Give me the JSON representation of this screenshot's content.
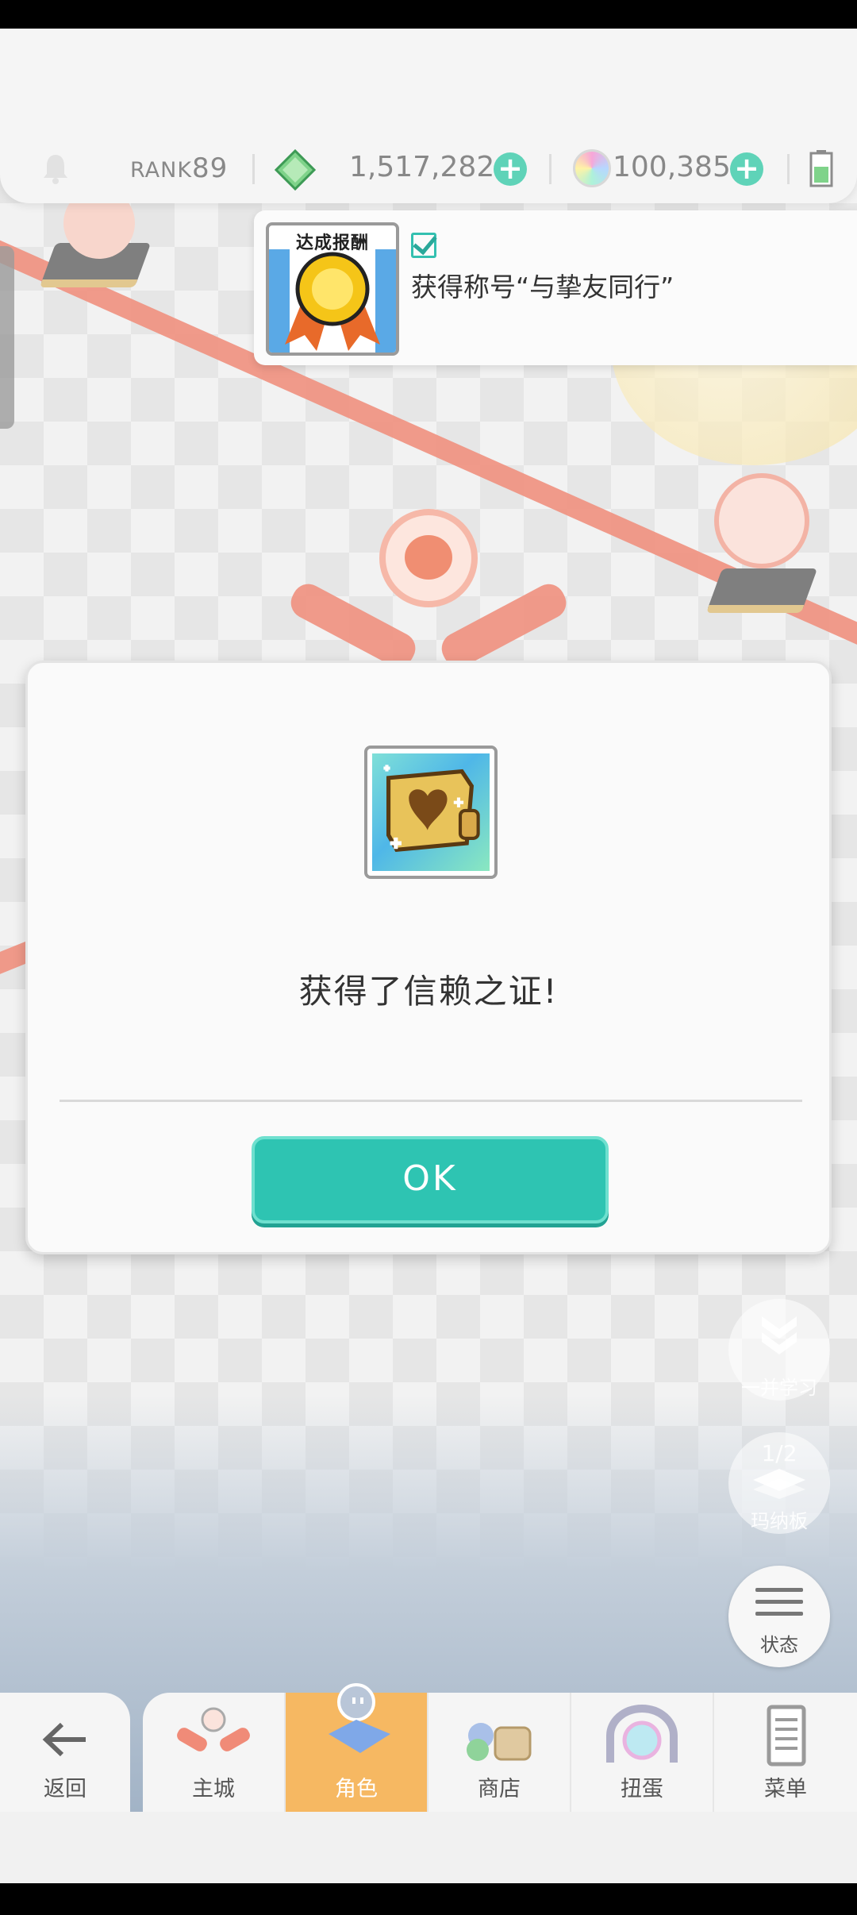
{
  "topbar": {
    "rank_prefix": "RANK",
    "rank_value": "89",
    "gems": "1,517,282",
    "orbs": "100,385",
    "plus_symbol": "+"
  },
  "toast": {
    "badge_label": "达成报酬",
    "message": "获得称号“与挚友同行”"
  },
  "dialog": {
    "message": "获得了信赖之证!",
    "ok_label": "OK"
  },
  "side_buttons": {
    "study_label": "一并学习",
    "page_indicator": "1/2",
    "board_label": "玛纳板",
    "status_label": "状态"
  },
  "nav": {
    "back_label": "返回",
    "items": [
      {
        "label": "主城"
      },
      {
        "label": "角色"
      },
      {
        "label": "商店"
      },
      {
        "label": "扭蛋"
      },
      {
        "label": "菜单"
      }
    ]
  },
  "colors": {
    "accent": "#2ec4b2",
    "active_tab": "#f6b862",
    "road": "#f08b78"
  }
}
